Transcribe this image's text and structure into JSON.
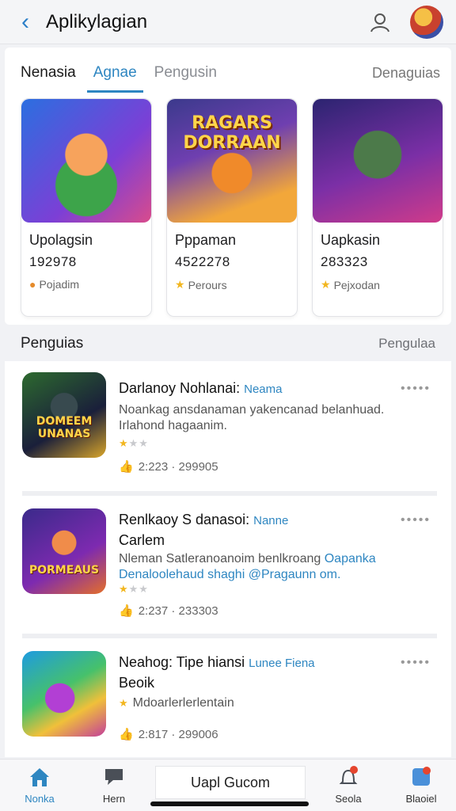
{
  "header": {
    "title": "Aplikylagian",
    "back_icon": "chevron-left-icon",
    "user_icon": "user-icon",
    "avatar": "avatar"
  },
  "tabs": {
    "items": [
      "Nenasia",
      "Agnae",
      "Pengusin"
    ],
    "active": 1,
    "right_label": "Denaguias"
  },
  "featured": [
    {
      "art_text": "",
      "name": "Upolagsin",
      "number": "192978",
      "tag": "Pojadim",
      "tag_icon_color": "#e58b2b"
    },
    {
      "art_text": "RAGARS DORRAAN",
      "name": "Pppaman",
      "number": "4522278",
      "tag": "Perours",
      "tag_icon_color": "#f2b61f"
    },
    {
      "art_text": "",
      "name": "Uapkasin",
      "number": "283323",
      "tag": "Pejxodan",
      "tag_icon_color": "#f2b61f"
    }
  ],
  "section": {
    "title": "Penguias",
    "more": "Pengulaa"
  },
  "list": [
    {
      "thumb_text": "DOMEEM UNANAS",
      "title": "Darlanoy Nohlanai:",
      "title_link": "Neama",
      "desc": "Noankag ansdanaman yakencanad belanhuad. Irlahond hagaanim.",
      "desc_link": "",
      "rating": 1,
      "meta": "2:223 ·  299905"
    },
    {
      "thumb_text": "PORMEAUS",
      "title": "Renlkaoy S danasoi:",
      "title_link": "Nanne",
      "title_line2": "Carlem",
      "desc": "Nleman Satleranoanoim benlkroang",
      "desc_link": "Oapanka",
      "desc_line2": "Denaloolehaud shaghi",
      "desc_link2": "@Pragaunn om.",
      "rating": 1,
      "meta": "2:237 ·  233303"
    },
    {
      "thumb_text": "",
      "title": "Neahog: Tipe hiansi",
      "title_link": "Lunee  Fiena",
      "title_line2": "Beoik",
      "desc": "Mdoarlerlerlentain",
      "desc_link": "",
      "rating": 1,
      "meta": "2:817 ·  299006"
    }
  ],
  "bottom_nav": {
    "items": [
      "Nonka",
      "Hern",
      "Seola",
      "Blaoiel"
    ],
    "active": 0,
    "search_label": "Uapl Gucom"
  },
  "colors": {
    "accent": "#2e86c1",
    "star": "#f2b61f"
  }
}
